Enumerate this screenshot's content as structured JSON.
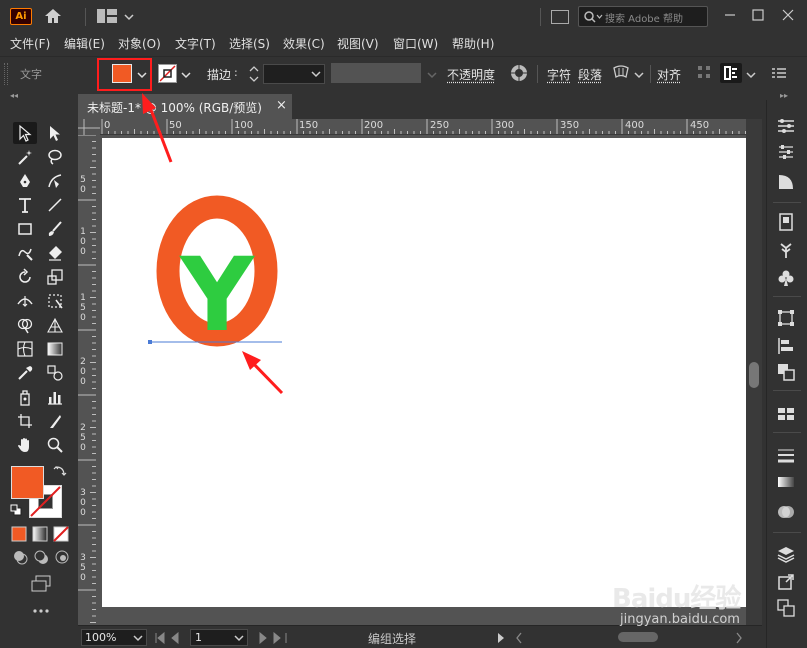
{
  "app": {
    "logo_text": "Ai",
    "search_placeholder": "搜索 Adobe 帮助",
    "colors": {
      "accent": "#ff7c00",
      "fill": "#f15a24",
      "y_green": "#2ecc40",
      "annotation": "#ff1d1d"
    }
  },
  "menubar": {
    "items": [
      "文件(F)",
      "编辑(E)",
      "对象(O)",
      "文字(T)",
      "选择(S)",
      "效果(C)",
      "视图(V)",
      "窗口(W)",
      "帮助(H)"
    ]
  },
  "controlbar": {
    "selection_label": "文字",
    "stroke_label": "描边",
    "opacity_label": "不透明度",
    "character_label": "字符",
    "paragraph_label": "段落",
    "align_label": "对齐"
  },
  "document": {
    "tab_title": "未标题-1* @ 100% (RGB/预览)",
    "close_glyph": "×",
    "ruler_top": [
      "0",
      "50",
      "100",
      "150",
      "200",
      "250",
      "300",
      "350",
      "400",
      "450"
    ],
    "ruler_left": [
      [
        "5",
        "0"
      ],
      [
        "1",
        "0",
        "0"
      ],
      [
        "1",
        "5",
        "0"
      ],
      [
        "2",
        "0",
        "0"
      ],
      [
        "2",
        "5",
        "0"
      ],
      [
        "3",
        "0",
        "0"
      ],
      [
        "3",
        "5",
        "0"
      ]
    ],
    "artwork_text": "Y"
  },
  "statusbar": {
    "zoom": "100%",
    "page": "1",
    "status_text": "编组选择"
  },
  "watermark": {
    "main": "Baidu经验",
    "sub": "jingyan.baidu.com"
  }
}
